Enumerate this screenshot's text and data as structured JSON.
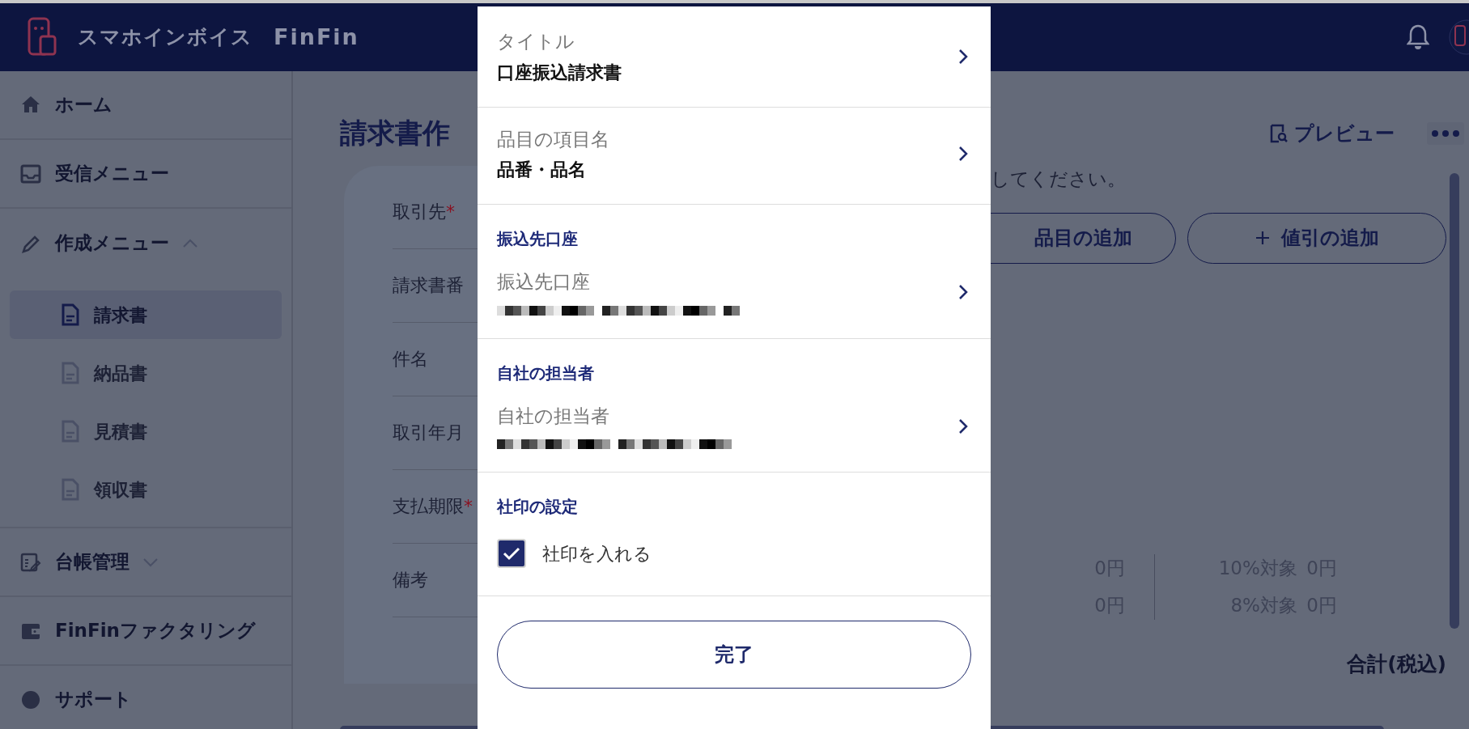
{
  "header": {
    "brand": "スマホインボイス",
    "brand_sub": "FinFin"
  },
  "sidebar": {
    "items": [
      {
        "kind": "link",
        "label": "ホーム",
        "selected": false
      },
      {
        "kind": "link",
        "label": "受信メニュー",
        "selected": false
      },
      {
        "kind": "group",
        "label": "作成メニュー",
        "expanded": true,
        "children": [
          {
            "label": "請求書",
            "selected": true
          },
          {
            "label": "納品書",
            "selected": false
          },
          {
            "label": "見積書",
            "selected": false
          },
          {
            "label": "領収書",
            "selected": false
          }
        ]
      },
      {
        "kind": "group",
        "label": "台帳管理",
        "expanded": false
      },
      {
        "kind": "link",
        "label": "FinFinファクタリング",
        "selected": false
      },
      {
        "kind": "link",
        "label": "サポート",
        "selected": false
      }
    ]
  },
  "page": {
    "title": "請求書作",
    "fields": [
      {
        "label": "取引先",
        "mark": "*"
      },
      {
        "label": "請求書番"
      },
      {
        "label": "件名"
      },
      {
        "label": "取引年月"
      },
      {
        "label": "支払期限",
        "mark": "*"
      },
      {
        "label": "備考"
      }
    ],
    "preview": "プレビュー",
    "hint": "してください。",
    "buttons": [
      {
        "label": "品目の追加",
        "plus": false
      },
      {
        "label": "値引の追加",
        "plus": true
      }
    ],
    "totals": [
      {
        "amount": "0円",
        "rate": "10%対象",
        "rate_amount": "0円"
      },
      {
        "amount": "0円",
        "rate": "8%対象",
        "rate_amount": "0円"
      }
    ],
    "total_label": "合計(税込)"
  },
  "modal": {
    "sections": [
      {
        "rows": [
          {
            "label": "タイトル",
            "value": "口座振込請求書"
          }
        ]
      },
      {
        "rows": [
          {
            "label": "品目の項目名",
            "value": "品番・品名"
          }
        ]
      },
      {
        "heading": "振込先口座",
        "rows": [
          {
            "label": "振込先口座",
            "value_hidden": true
          }
        ]
      },
      {
        "heading": "自社の担当者",
        "rows": [
          {
            "label": "自社の担当者",
            "value_hidden": true
          }
        ]
      },
      {
        "heading": "社印の設定",
        "checkbox": {
          "label": "社印を入れる",
          "checked": true
        }
      }
    ],
    "done": "完了"
  }
}
